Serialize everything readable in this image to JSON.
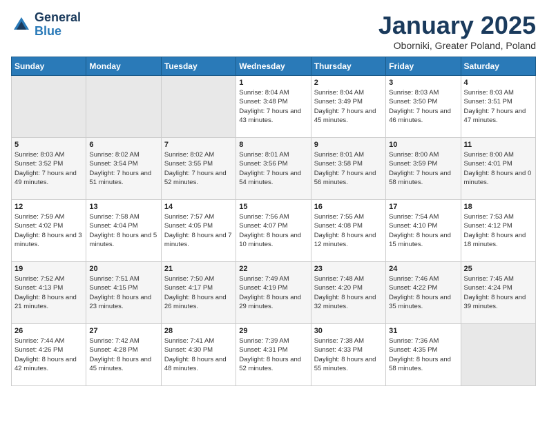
{
  "header": {
    "logo_line1": "General",
    "logo_line2": "Blue",
    "month": "January 2025",
    "location": "Oborniki, Greater Poland, Poland"
  },
  "days_of_week": [
    "Sunday",
    "Monday",
    "Tuesday",
    "Wednesday",
    "Thursday",
    "Friday",
    "Saturday"
  ],
  "weeks": [
    [
      {
        "day": "",
        "content": ""
      },
      {
        "day": "",
        "content": ""
      },
      {
        "day": "",
        "content": ""
      },
      {
        "day": "1",
        "content": "Sunrise: 8:04 AM\nSunset: 3:48 PM\nDaylight: 7 hours and 43 minutes."
      },
      {
        "day": "2",
        "content": "Sunrise: 8:04 AM\nSunset: 3:49 PM\nDaylight: 7 hours and 45 minutes."
      },
      {
        "day": "3",
        "content": "Sunrise: 8:03 AM\nSunset: 3:50 PM\nDaylight: 7 hours and 46 minutes."
      },
      {
        "day": "4",
        "content": "Sunrise: 8:03 AM\nSunset: 3:51 PM\nDaylight: 7 hours and 47 minutes."
      }
    ],
    [
      {
        "day": "5",
        "content": "Sunrise: 8:03 AM\nSunset: 3:52 PM\nDaylight: 7 hours and 49 minutes."
      },
      {
        "day": "6",
        "content": "Sunrise: 8:02 AM\nSunset: 3:54 PM\nDaylight: 7 hours and 51 minutes."
      },
      {
        "day": "7",
        "content": "Sunrise: 8:02 AM\nSunset: 3:55 PM\nDaylight: 7 hours and 52 minutes."
      },
      {
        "day": "8",
        "content": "Sunrise: 8:01 AM\nSunset: 3:56 PM\nDaylight: 7 hours and 54 minutes."
      },
      {
        "day": "9",
        "content": "Sunrise: 8:01 AM\nSunset: 3:58 PM\nDaylight: 7 hours and 56 minutes."
      },
      {
        "day": "10",
        "content": "Sunrise: 8:00 AM\nSunset: 3:59 PM\nDaylight: 7 hours and 58 minutes."
      },
      {
        "day": "11",
        "content": "Sunrise: 8:00 AM\nSunset: 4:01 PM\nDaylight: 8 hours and 0 minutes."
      }
    ],
    [
      {
        "day": "12",
        "content": "Sunrise: 7:59 AM\nSunset: 4:02 PM\nDaylight: 8 hours and 3 minutes."
      },
      {
        "day": "13",
        "content": "Sunrise: 7:58 AM\nSunset: 4:04 PM\nDaylight: 8 hours and 5 minutes."
      },
      {
        "day": "14",
        "content": "Sunrise: 7:57 AM\nSunset: 4:05 PM\nDaylight: 8 hours and 7 minutes."
      },
      {
        "day": "15",
        "content": "Sunrise: 7:56 AM\nSunset: 4:07 PM\nDaylight: 8 hours and 10 minutes."
      },
      {
        "day": "16",
        "content": "Sunrise: 7:55 AM\nSunset: 4:08 PM\nDaylight: 8 hours and 12 minutes."
      },
      {
        "day": "17",
        "content": "Sunrise: 7:54 AM\nSunset: 4:10 PM\nDaylight: 8 hours and 15 minutes."
      },
      {
        "day": "18",
        "content": "Sunrise: 7:53 AM\nSunset: 4:12 PM\nDaylight: 8 hours and 18 minutes."
      }
    ],
    [
      {
        "day": "19",
        "content": "Sunrise: 7:52 AM\nSunset: 4:13 PM\nDaylight: 8 hours and 21 minutes."
      },
      {
        "day": "20",
        "content": "Sunrise: 7:51 AM\nSunset: 4:15 PM\nDaylight: 8 hours and 23 minutes."
      },
      {
        "day": "21",
        "content": "Sunrise: 7:50 AM\nSunset: 4:17 PM\nDaylight: 8 hours and 26 minutes."
      },
      {
        "day": "22",
        "content": "Sunrise: 7:49 AM\nSunset: 4:19 PM\nDaylight: 8 hours and 29 minutes."
      },
      {
        "day": "23",
        "content": "Sunrise: 7:48 AM\nSunset: 4:20 PM\nDaylight: 8 hours and 32 minutes."
      },
      {
        "day": "24",
        "content": "Sunrise: 7:46 AM\nSunset: 4:22 PM\nDaylight: 8 hours and 35 minutes."
      },
      {
        "day": "25",
        "content": "Sunrise: 7:45 AM\nSunset: 4:24 PM\nDaylight: 8 hours and 39 minutes."
      }
    ],
    [
      {
        "day": "26",
        "content": "Sunrise: 7:44 AM\nSunset: 4:26 PM\nDaylight: 8 hours and 42 minutes."
      },
      {
        "day": "27",
        "content": "Sunrise: 7:42 AM\nSunset: 4:28 PM\nDaylight: 8 hours and 45 minutes."
      },
      {
        "day": "28",
        "content": "Sunrise: 7:41 AM\nSunset: 4:30 PM\nDaylight: 8 hours and 48 minutes."
      },
      {
        "day": "29",
        "content": "Sunrise: 7:39 AM\nSunset: 4:31 PM\nDaylight: 8 hours and 52 minutes."
      },
      {
        "day": "30",
        "content": "Sunrise: 7:38 AM\nSunset: 4:33 PM\nDaylight: 8 hours and 55 minutes."
      },
      {
        "day": "31",
        "content": "Sunrise: 7:36 AM\nSunset: 4:35 PM\nDaylight: 8 hours and 58 minutes."
      },
      {
        "day": "",
        "content": ""
      }
    ]
  ]
}
